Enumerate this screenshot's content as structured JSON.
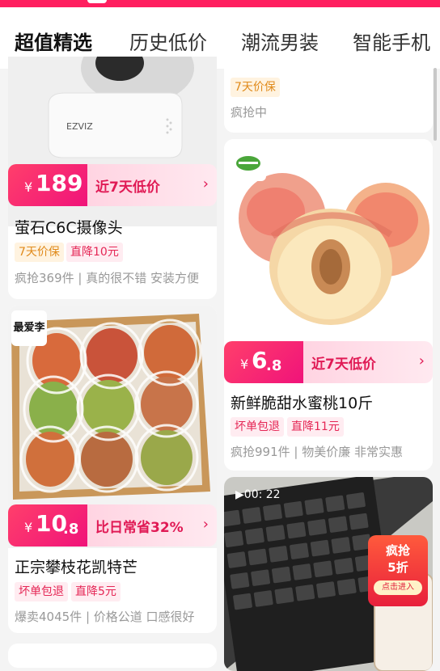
{
  "tabs": [
    "超值精选",
    "历史低价",
    "潮流男装",
    "智能手机"
  ],
  "products": {
    "camera": {
      "brand": "EZVIZ",
      "price_int": "189",
      "price_dec": "",
      "promo": "近7天低价",
      "title": "萤石C6C摄像头",
      "tags": [
        "7天价保",
        "直降10元"
      ],
      "meta": "疯抢369件 | 真的很不错 安装方便"
    },
    "top_right": {
      "tags": [
        "7天价保"
      ],
      "meta": "疯抢中"
    },
    "peach": {
      "price_int": "6",
      "price_dec": ".8",
      "promo": "近7天低价",
      "title": "新鲜脆甜水蜜桃10斤",
      "tags": [
        "坏单包退",
        "直降11元"
      ],
      "meta": "疯抢991件 | 物美价廉 非常实惠"
    },
    "mango": {
      "corner_label": "最爱李",
      "price_int": "10",
      "price_dec": ".8",
      "promo": "比日常省32%",
      "title": "正宗攀枝花凯特芒",
      "tags": [
        "坏单包退",
        "直降5元"
      ],
      "meta": "爆卖4045件 | 价格公道 口感很好"
    },
    "video": {
      "duration": "00: 22",
      "badge_line1": "疯抢",
      "badge_line2": "5折",
      "badge_button": "点击进入"
    }
  },
  "currency_symbol": "¥",
  "colors": {
    "accent": "#ff1f5f",
    "promo_text": "#e01a55"
  }
}
